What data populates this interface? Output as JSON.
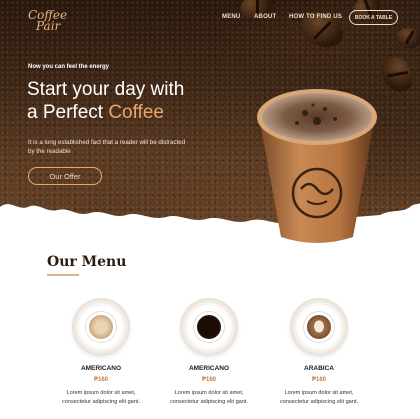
{
  "brand": {
    "line1": "Coffee",
    "line2": "Pair"
  },
  "nav": {
    "items": [
      "MENU",
      "ABOUT",
      "HOW TO FIND US"
    ],
    "cta": "BOOK A TABLE"
  },
  "hero": {
    "tagline": "Now you can feel the energy",
    "headline_part1": "Start your day with",
    "headline_part2": "a Perfect ",
    "headline_accent": "Coffee",
    "description": "It is a long established fact that a reader will be distracted by the readable",
    "button": "Our Offer"
  },
  "menu": {
    "title": "Our Menu",
    "items": [
      {
        "name": "AMERICANO",
        "price": "₱160",
        "desc1": "Lorem ipsum dolor sit amet,",
        "desc2": "consectetur adipiscing elit gant."
      },
      {
        "name": "AMERICANO",
        "price": "₱160",
        "desc1": "Lorem ipsum dolor sit amet,",
        "desc2": "consectetur adipiscing elit gant."
      },
      {
        "name": "ARABICA",
        "price": "₱160",
        "desc1": "Lorem ipsum dolor sit amet,",
        "desc2": "consectetur adipiscing elit gant."
      }
    ]
  },
  "colors": {
    "accent": "#e8a86c",
    "price": "#c37a3e",
    "dark": "#2b1a10"
  }
}
